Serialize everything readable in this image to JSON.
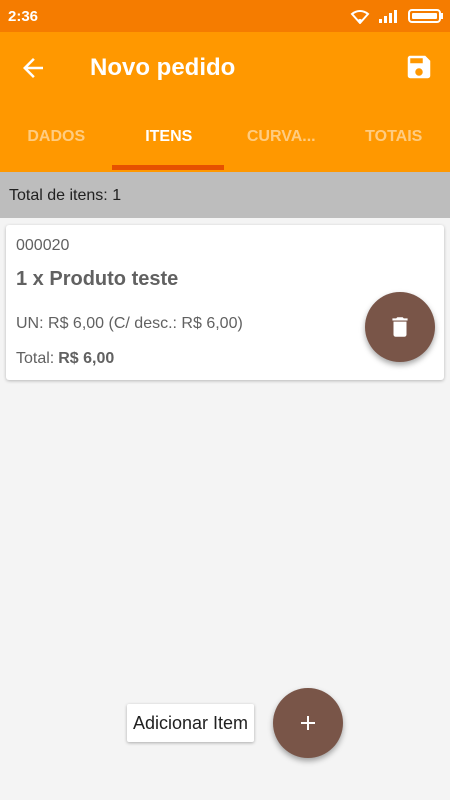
{
  "status_bar": {
    "time": "2:36"
  },
  "app_bar": {
    "title": "Novo pedido"
  },
  "tabs": [
    {
      "label": "DADOS",
      "active": false
    },
    {
      "label": "ITENS",
      "active": true
    },
    {
      "label": "CURVA...",
      "active": false
    },
    {
      "label": "TOTAIS",
      "active": false
    }
  ],
  "summary": {
    "label": "Total de itens:",
    "count": "1"
  },
  "items": [
    {
      "code": "000020",
      "description": "1 x Produto teste",
      "unit_label": "UN:",
      "unit_price": "R$ 6,00",
      "discount_text": "(C/ desc.: R$ 6,00)",
      "total_label": "Total:",
      "total_value": "R$ 6,00"
    }
  ],
  "actions": {
    "add_item_label": "Adicionar Item"
  },
  "colors": {
    "primary": "#ff9800",
    "primary_dark": "#f57c00",
    "accent": "#795548",
    "indicator": "#e65100"
  }
}
